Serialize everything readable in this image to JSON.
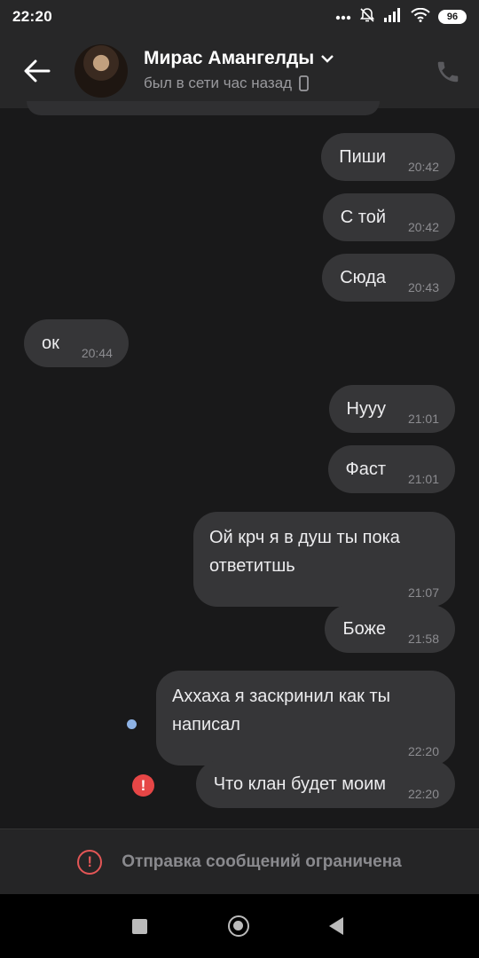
{
  "status_bar": {
    "time": "22:20",
    "battery": "96"
  },
  "header": {
    "contact_name": "Мирас Амангелды",
    "last_seen": "был в сети час назад"
  },
  "messages": [
    {
      "text": "Пиши",
      "time": "20:42",
      "direction": "out"
    },
    {
      "text": "С той",
      "time": "20:42",
      "direction": "out"
    },
    {
      "text": "Сюда",
      "time": "20:43",
      "direction": "out"
    },
    {
      "text": "ок",
      "time": "20:44",
      "direction": "in"
    },
    {
      "text": "Нууу",
      "time": "21:01",
      "direction": "out"
    },
    {
      "text": "Фаст",
      "time": "21:01",
      "direction": "out"
    },
    {
      "text": "Ой крч я в душ ты пока ответитшь",
      "time": "21:07",
      "direction": "out"
    },
    {
      "text": "Боже",
      "time": "21:58",
      "direction": "out"
    },
    {
      "text": "Аххаха я заскринил как ты написал",
      "time": "22:20",
      "direction": "out",
      "status": "unread"
    },
    {
      "text": "Что клан будет моим",
      "time": "22:20",
      "direction": "out",
      "status": "failed"
    }
  ],
  "footer": {
    "restricted_text": "Отправка сообщений ограничена"
  },
  "colors": {
    "background": "#19191a",
    "bubble": "#363638",
    "error": "#e64646",
    "unread_dot": "#8eb3e6"
  }
}
